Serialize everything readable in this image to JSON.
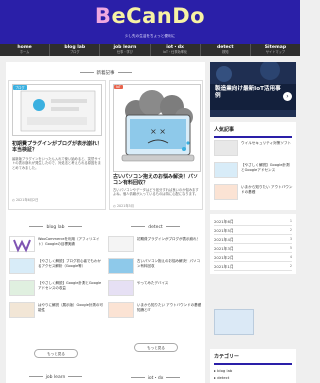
{
  "site": {
    "logo_b": "B",
    "logo_rest": "eCanDo",
    "tagline": "少し先の生活をちょっと便利に"
  },
  "nav": [
    {
      "en": "home",
      "jp": "ホーム"
    },
    {
      "en": "blog lab",
      "jp": "ブログ"
    },
    {
      "en": "job learn",
      "jp": "仕事・学び"
    },
    {
      "en": "iot・dx",
      "jp": "IoT・仕事効率化"
    },
    {
      "en": "detect",
      "jp": "検知"
    },
    {
      "en": "Sitemap",
      "jp": "サイトマップ"
    }
  ],
  "main": {
    "new_section": "新着記事",
    "card1": {
      "tag": "ブログ",
      "title": "初期費プラグインがブログが表示崩れ！本当検証？",
      "excerpt": "最新版プラグインをいったん入れて使い始めると、突然サイトの表示崩れが発生したので、対処法と考えられる原因をまとめてみました。",
      "date": "2021年6月2日"
    },
    "card2": {
      "tag": "IoT",
      "title": "古いパソコン抱えのお悩み解決！パソコン有料回収？",
      "excerpt": "古いパソコンやデータはどう処分すれば良いのか悩みますよね。個人情報が入っているものは特に心配になります。",
      "date": "2021年5月"
    },
    "blog_section": "blog lab",
    "detect_section": "detect",
    "blog_items": [
      "WooCommerceを利用（アフィリエイト）Googleの目標実績",
      "【やさしく解説】ブログ初心者でもわかるアクセス解析（Google等）",
      "【やさしく解説】Google計測とGoogleアドセンスの収益",
      "はやりに解説（展示版）Google計測の可能性"
    ],
    "detect_items": [
      "初期費プラグインがブログが表示崩れ！",
      "古いパソコン抱えのお悩み解決！パソコン有料回収",
      "やってみたデバイス",
      "いまから知りたい アウトバウンドの基礎知識とIT"
    ],
    "more1": "もっと見る",
    "more2": "もっと見る",
    "job_section": "job learn",
    "iot_section": "iot・dx"
  },
  "sidebar": {
    "banner_text": "製造業向け最新IoT活用事例",
    "popular_title": "人気記事",
    "popular": [
      "ウイルセキュリティ対策ソフト",
      "【やさしく解説】Google計測とGoogleアドセンス",
      "いまから知りたい アウトバウンドの基礎"
    ],
    "archive": [
      {
        "label": "2021年6月",
        "count": "1"
      },
      {
        "label": "2021年5月",
        "count": "2"
      },
      {
        "label": "2021年4月",
        "count": "3"
      },
      {
        "label": "2021年3月",
        "count": "5"
      },
      {
        "label": "2021年2月",
        "count": "4"
      },
      {
        "label": "2021年1月",
        "count": "2"
      }
    ],
    "category_title": "カテゴリー",
    "categories": [
      "blog lab",
      "detect"
    ]
  }
}
